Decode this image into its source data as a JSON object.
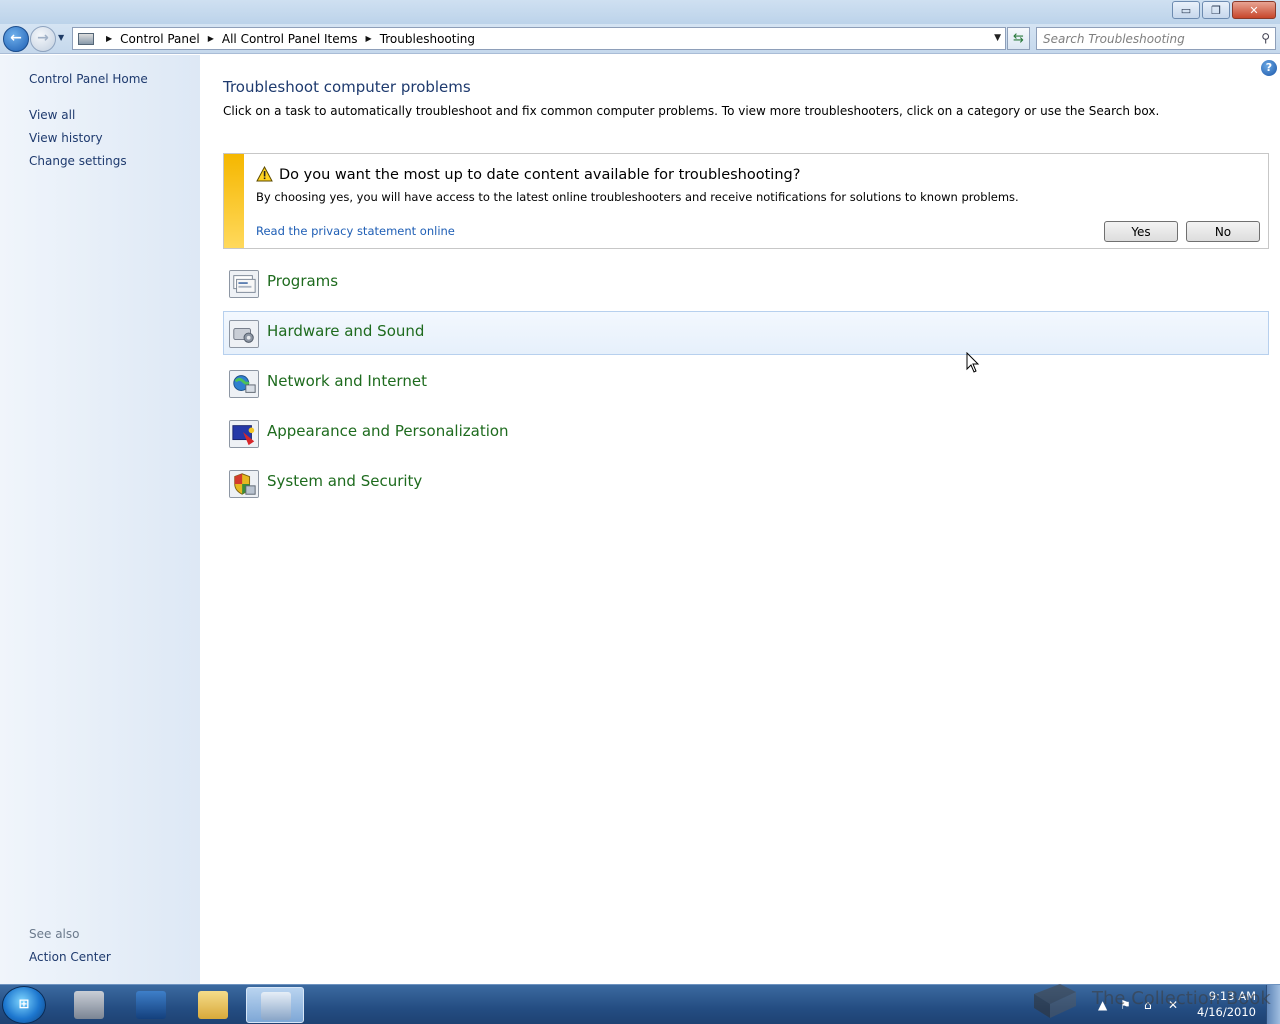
{
  "window": {
    "controls": {
      "minimize": "▭",
      "restore": "❐",
      "close": "✕"
    }
  },
  "address_bar": {
    "breadcrumbs": [
      "Control Panel",
      "All Control Panel Items",
      "Troubleshooting"
    ],
    "search_placeholder": "Search Troubleshooting"
  },
  "sidebar": {
    "home_link": "Control Panel Home",
    "links": [
      "View all",
      "View history",
      "Change settings"
    ],
    "see_also_label": "See also",
    "see_also_links": [
      "Action Center"
    ]
  },
  "main": {
    "title": "Troubleshoot computer problems",
    "intro": "Click on a task to automatically troubleshoot and fix common computer problems. To view more troubleshooters, click on a category or use the Search box.",
    "banner": {
      "question": "Do you want the most up to date content available for troubleshooting?",
      "description": "By choosing yes, you will have access to the latest online troubleshooters and receive notifications for solutions to known problems.",
      "privacy_link": "Read the privacy statement online",
      "yes_label": "Yes",
      "no_label": "No"
    },
    "categories": [
      {
        "label": "Programs",
        "icon": "programs-icon"
      },
      {
        "label": "Hardware and Sound",
        "icon": "hardware-sound-icon"
      },
      {
        "label": "Network and Internet",
        "icon": "network-internet-icon"
      },
      {
        "label": "Appearance and Personalization",
        "icon": "appearance-icon"
      },
      {
        "label": "System and Security",
        "icon": "system-security-icon"
      }
    ],
    "hovered_category": "Hardware and Sound"
  },
  "taskbar": {
    "clock_time": "9:13 AM",
    "clock_date": "4/16/2010",
    "watermark": "The Collection Book"
  },
  "colors": {
    "link": "#1e3a6e",
    "category_text": "#1e6b1e",
    "banner_stripe": "#f5b700",
    "taskbar": "#244d82"
  }
}
